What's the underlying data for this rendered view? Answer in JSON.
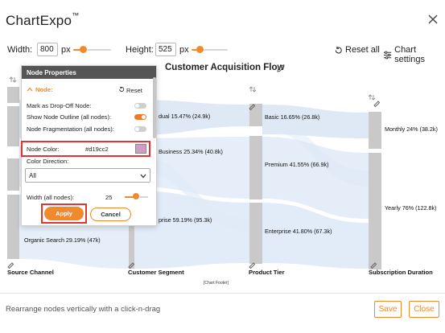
{
  "app": {
    "title": "ChartExpo",
    "trademark": "™"
  },
  "toolbar": {
    "width_label": "Width:",
    "width_value": "800",
    "width_unit": "px",
    "height_label": "Height:",
    "height_value": "525",
    "height_unit": "px",
    "reset_all": "Reset all",
    "chart_settings": "Chart settings"
  },
  "chart": {
    "title": "Customer Acquisition Flow",
    "footer": "[Chart Footer]",
    "axes": [
      "Source Channel",
      "Customer Segment",
      "Product Tier",
      "Subscription Duration"
    ],
    "labels": {
      "organic": "Organic Search 29.19% (47k)",
      "individual": "dual 15.47% (24.9k)",
      "business": "Business 25.34% (40.8k)",
      "enterprise_seg": "prise 59.19% (95.3k)",
      "basic": "Basic 16.65% (26.8k)",
      "premium": "Premium 41.55% (66.9k)",
      "enterprise_tier": "Enterprise 41.80% (67.3k)",
      "monthly": "Monthly 24% (38.2k)",
      "yearly": "Yearly 76% (122.8k)"
    },
    "node_color": "#d19cc2",
    "flow_color": "#dbe6f5"
  },
  "panel": {
    "header": "Node Properties",
    "section": "Node:",
    "reset": "Reset",
    "drop_off": "Mark as Drop-Off Node:",
    "drop_off_on": false,
    "outline": "Show Node Outline (all nodes):",
    "outline_on": true,
    "fragmentation": "Node Fragmentation (all nodes):",
    "fragmentation_on": false,
    "node_color_label": "Node Color:",
    "node_color_value": "#d19cc2",
    "color_direction_label": "Color Direction:",
    "color_direction_value": "All",
    "width_label": "Width (all nodes):",
    "width_value": "25",
    "apply": "Apply",
    "cancel": "Cancel"
  },
  "footer": {
    "hint": "Rearrange nodes vertically with a click-n-drag",
    "save": "Save",
    "close": "Close"
  }
}
